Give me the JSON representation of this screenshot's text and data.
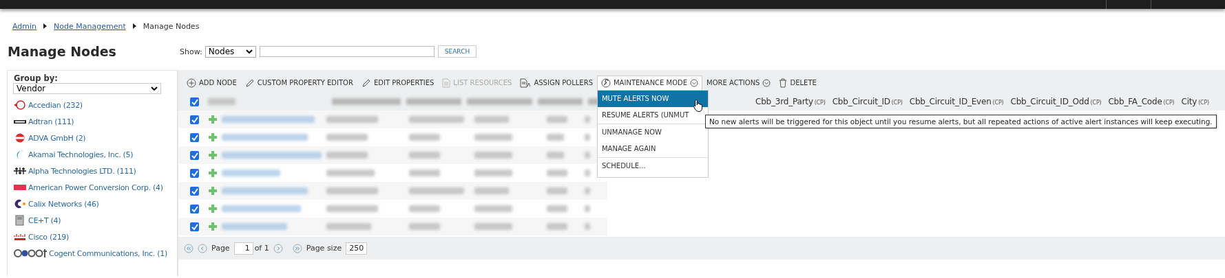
{
  "breadcrumb": [
    {
      "label": "Admin",
      "kind": "link"
    },
    {
      "label": "Node Management",
      "kind": "link"
    },
    {
      "label": "Manage Nodes",
      "kind": "current"
    }
  ],
  "page_title": "Manage Nodes",
  "show_filter": {
    "label": "Show:",
    "value": "Nodes",
    "search_button": "SEARCH"
  },
  "sidebar": {
    "group_by_label": "Group by:",
    "group_by_value": "Vendor",
    "items": [
      {
        "label": "Accedian (232)"
      },
      {
        "label": "Adtran (111)"
      },
      {
        "label": "ADVA GmbH (2)"
      },
      {
        "label": "Akamai Technologies, Inc. (5)"
      },
      {
        "label": "Alpha Technologies LTD. (111)"
      },
      {
        "label": "American Power Conversion Corp. (4)"
      },
      {
        "label": "Calix Networks (46)"
      },
      {
        "label": "CE+T (4)"
      },
      {
        "label": "Cisco (219)"
      },
      {
        "label": "Cogent Communications, Inc. (1)"
      }
    ]
  },
  "toolbar": [
    {
      "label": "ADD NODE",
      "disabled": false,
      "dropdown": false,
      "open": false
    },
    {
      "label": "CUSTOM PROPERTY EDITOR",
      "disabled": false,
      "dropdown": false,
      "open": false
    },
    {
      "label": "EDIT PROPERTIES",
      "disabled": false,
      "dropdown": false,
      "open": false
    },
    {
      "label": "LIST RESOURCES",
      "disabled": true,
      "dropdown": false,
      "open": false
    },
    {
      "label": "ASSIGN POLLERS",
      "disabled": false,
      "dropdown": false,
      "open": false
    },
    {
      "label": "MAINTENANCE MODE",
      "disabled": false,
      "dropdown": true,
      "open": true
    },
    {
      "label": "MORE ACTIONS",
      "disabled": false,
      "dropdown": true,
      "open": false
    },
    {
      "label": "DELETE",
      "disabled": false,
      "dropdown": false,
      "open": false
    }
  ],
  "maintenance_menu": [
    {
      "label": "MUTE ALERTS NOW",
      "highlighted": true,
      "divider_after": false
    },
    {
      "label": "RESUME ALERTS (UNMUT",
      "highlighted": false,
      "divider_after": true
    },
    {
      "label": "UNMANAGE NOW",
      "highlighted": false,
      "divider_after": false
    },
    {
      "label": "MANAGE AGAIN",
      "highlighted": false,
      "divider_after": true
    },
    {
      "label": "SCHEDULE...",
      "highlighted": false,
      "divider_after": false
    }
  ],
  "tooltip": "No new alerts will be triggered for this object until you resume alerts, but all repeated actions of active alert instances will keep executing.",
  "table": {
    "header_checked": true,
    "columns": [
      {
        "label": "Cbb_3rd_Party",
        "tag": "(CP)"
      },
      {
        "label": "Cbb_Circuit_ID",
        "tag": "(CP)"
      },
      {
        "label": "Cbb_Circuit_ID_Even",
        "tag": "(CP)"
      },
      {
        "label": "Cbb_Circuit_ID_Odd",
        "tag": "(CP)"
      },
      {
        "label": "Cbb_FA_Code",
        "tag": "(CP)"
      },
      {
        "label": "City",
        "tag": "(CP)"
      }
    ],
    "rows": [
      {
        "checked": true
      },
      {
        "checked": true
      },
      {
        "checked": true
      },
      {
        "checked": true
      },
      {
        "checked": true
      },
      {
        "checked": true
      },
      {
        "checked": true
      }
    ]
  },
  "pager": {
    "page_label": "Page",
    "page": "1",
    "of_label": "of 1",
    "page_size_label": "Page size",
    "page_size": "250"
  }
}
